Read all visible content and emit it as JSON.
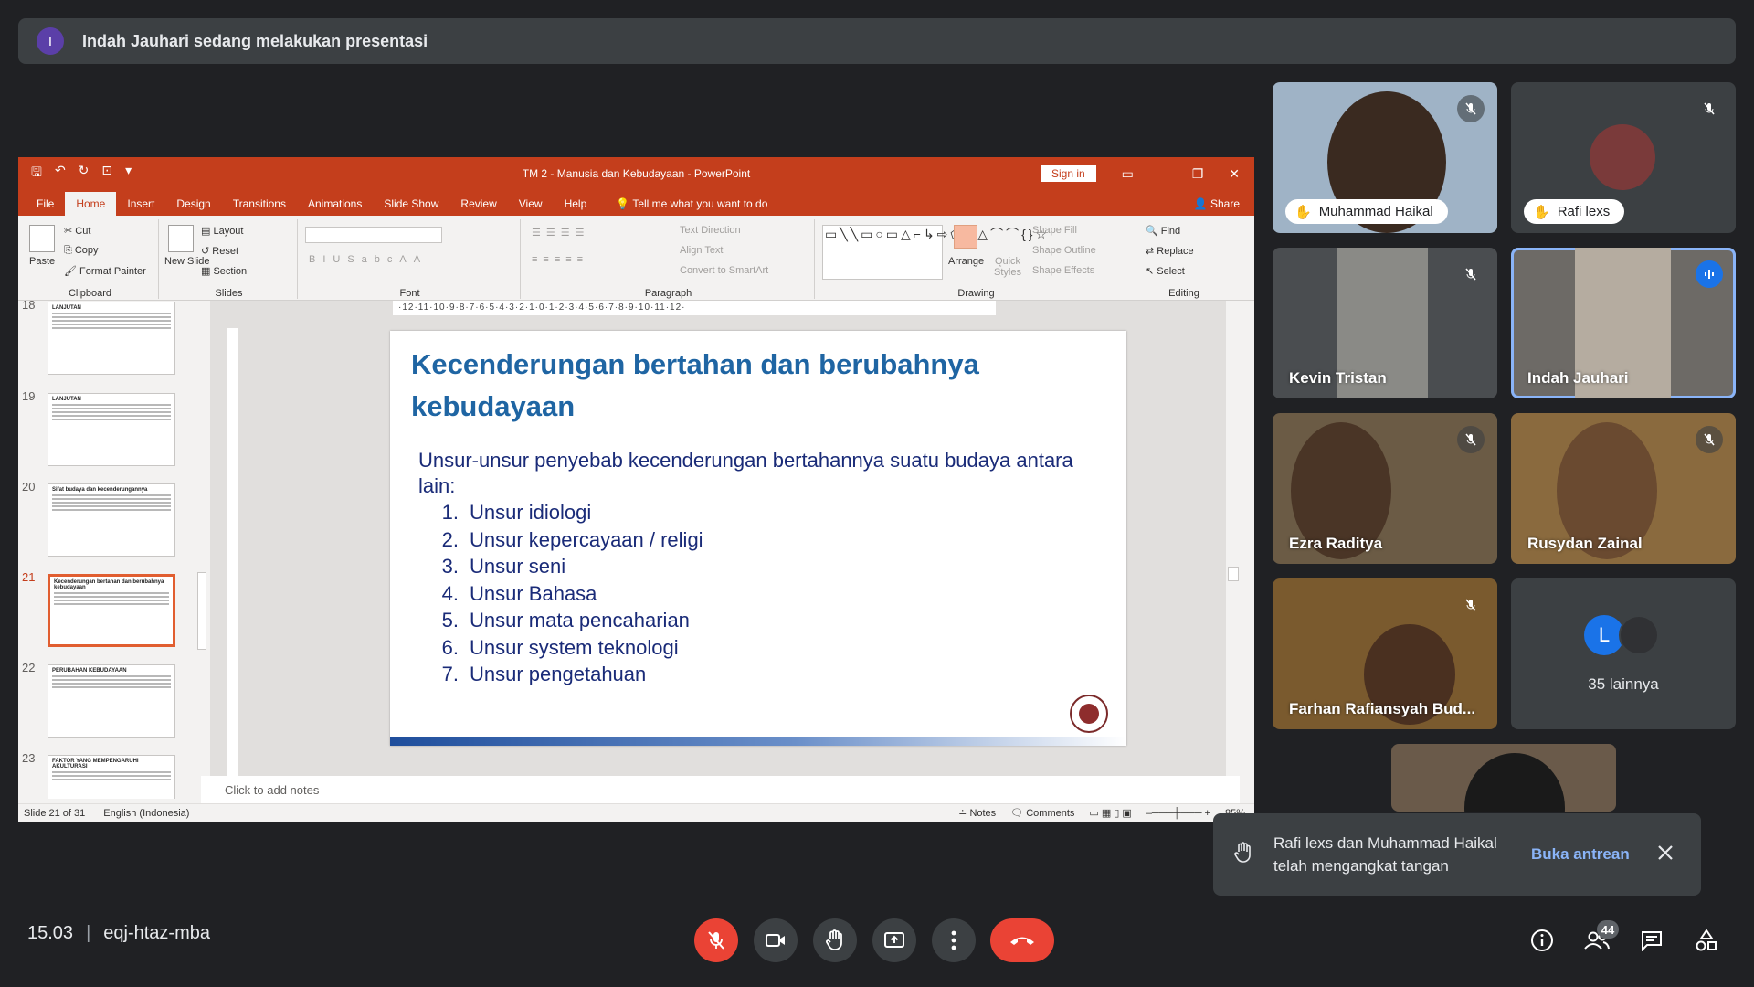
{
  "banner": {
    "avatar_letter": "I",
    "text": "Indah Jauhari sedang melakukan presentasi"
  },
  "ppt": {
    "window_title": "TM 2 - Manusia dan Kebudayaan  -  PowerPoint",
    "sign_in": "Sign in",
    "tabs": [
      "File",
      "Home",
      "Insert",
      "Design",
      "Transitions",
      "Animations",
      "Slide Show",
      "Review",
      "View",
      "Help"
    ],
    "active_tab": "Home",
    "tell_me": "Tell me what you want to do",
    "share": "Share",
    "ribbon": {
      "clipboard": {
        "label": "Clipboard",
        "paste": "Paste",
        "cut": "Cut",
        "copy": "Copy",
        "format_painter": "Format Painter"
      },
      "slides": {
        "label": "Slides",
        "new_slide": "New Slide",
        "layout": "Layout",
        "reset": "Reset",
        "section": "Section"
      },
      "font": {
        "label": "Font"
      },
      "paragraph": {
        "label": "Paragraph",
        "text_direction": "Text Direction",
        "align_text": "Align Text",
        "convert_smartart": "Convert to SmartArt"
      },
      "drawing": {
        "label": "Drawing",
        "arrange": "Arrange",
        "quick_styles": "Quick Styles",
        "shape_fill": "Shape Fill",
        "shape_outline": "Shape Outline",
        "shape_effects": "Shape Effects"
      },
      "editing": {
        "label": "Editing",
        "find": "Find",
        "replace": "Replace",
        "select": "Select"
      }
    },
    "ruler_text": "·12·11·10·9·8·7·6·5·4·3·2·1·0·1·2·3·4·5·6·7·8·9·10·11·12·",
    "thumbnails": [
      {
        "num": "18",
        "title": "LANJUTAN",
        "active": false
      },
      {
        "num": "19",
        "title": "LANJUTAN",
        "active": false
      },
      {
        "num": "20",
        "title": "Sifat budaya dan kecenderungannya",
        "active": false
      },
      {
        "num": "21",
        "title": "Kecenderungan bertahan dan berubahnya kebudayaan",
        "active": true
      },
      {
        "num": "22",
        "title": "PERUBAHAN KEBUDAYAAN",
        "active": false
      },
      {
        "num": "23",
        "title": "FAKTOR YANG MEMPENGARUHI AKULTURASI",
        "active": false
      }
    ],
    "slide": {
      "title": "Kecenderungan bertahan dan berubahnya kebudayaan",
      "intro": "Unsur-unsur penyebab kecenderungan bertahannya suatu budaya antara lain:",
      "items": [
        {
          "n": "1.",
          "text": "Unsur idiologi"
        },
        {
          "n": "2.",
          "text": "Unsur kepercayaan / religi"
        },
        {
          "n": "3.",
          "text": "Unsur seni"
        },
        {
          "n": "4.",
          "text": "Unsur Bahasa"
        },
        {
          "n": "5.",
          "text": "Unsur mata pencaharian"
        },
        {
          "n": "6.",
          "text": "Unsur system teknologi"
        },
        {
          "n": "7.",
          "text": "Unsur pengetahuan"
        }
      ]
    },
    "notes_placeholder": "Click to add notes",
    "status": {
      "slide": "Slide 21 of 31",
      "language": "English (Indonesia)",
      "notes": "Notes",
      "comments": "Comments",
      "zoom": "85%"
    }
  },
  "participants": [
    {
      "name": "Muhammad Haikal",
      "hand": true,
      "speaking": false,
      "bg": "#9fb3c6"
    },
    {
      "name": "Rafi lexs",
      "hand": true,
      "speaking": false,
      "bg": "#3c4043"
    },
    {
      "name": "Kevin Tristan",
      "hand": false,
      "speaking": false,
      "bg": "#4a4d50"
    },
    {
      "name": "Indah Jauhari",
      "hand": false,
      "speaking": true,
      "bg": "#6d6a66"
    },
    {
      "name": "Ezra Raditya",
      "hand": false,
      "speaking": false,
      "bg": "#6b5b45"
    },
    {
      "name": "Rusydan Zainal",
      "hand": false,
      "speaking": false,
      "bg": "#8a6a3e"
    },
    {
      "name": "Farhan Rafiansyah Bud...",
      "hand": false,
      "speaking": false,
      "bg": "#7a5a2e"
    }
  ],
  "others": {
    "avatar_letter": "L",
    "label": "35 lainnya",
    "avatar_color": "#1a73e8"
  },
  "toast": {
    "message": "Rafi lexs dan Muhammad Haikal telah mengangkat tangan",
    "action": "Buka antrean"
  },
  "meeting": {
    "time": "15.03",
    "code": "eqj-htaz-mba",
    "people_count": "44"
  },
  "colors": {
    "ppt_red": "#c43e1c",
    "meet_bg": "#202124",
    "end_call": "#ea4335",
    "accent_blue": "#8ab4f8",
    "slide_title": "#1f65a3"
  }
}
